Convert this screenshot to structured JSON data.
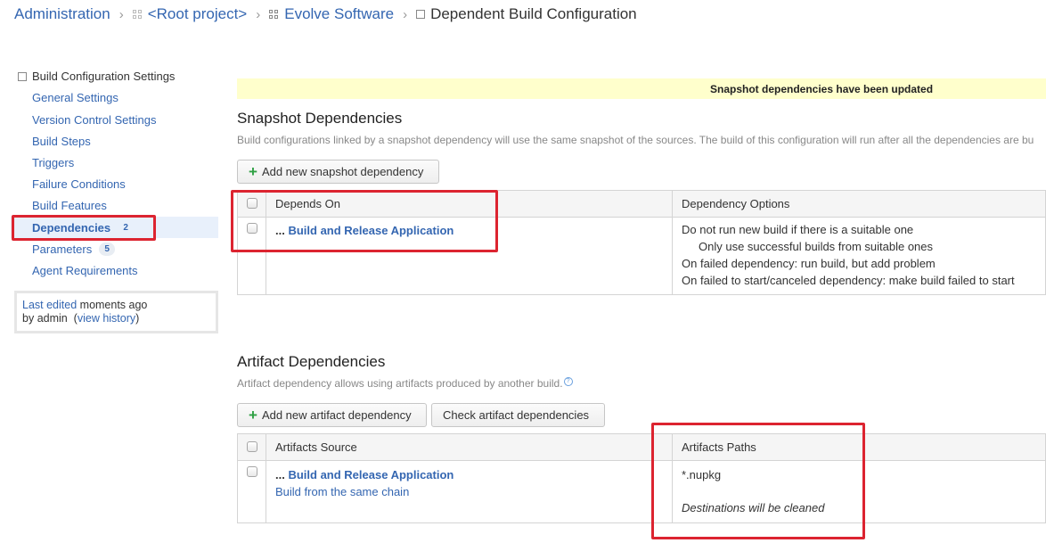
{
  "breadcrumb": {
    "items": [
      {
        "label": "Administration",
        "icon": null
      },
      {
        "label": "<Root project>",
        "icon": "project-icon"
      },
      {
        "label": "Evolve Software",
        "icon": "project-icon"
      }
    ],
    "current": {
      "label": "Dependent Build Configuration",
      "icon": "build-config-icon"
    },
    "separator": "›"
  },
  "sidebar": {
    "header": "Build Configuration Settings",
    "items": [
      {
        "label": "General Settings",
        "badge": null,
        "active": false
      },
      {
        "label": "Version Control Settings",
        "badge": null,
        "active": false
      },
      {
        "label": "Build Steps",
        "badge": null,
        "active": false
      },
      {
        "label": "Triggers",
        "badge": null,
        "active": false
      },
      {
        "label": "Failure Conditions",
        "badge": null,
        "active": false
      },
      {
        "label": "Build Features",
        "badge": null,
        "active": false
      },
      {
        "label": "Dependencies",
        "badge": "2",
        "active": true
      },
      {
        "label": "Parameters",
        "badge": "5",
        "active": false
      },
      {
        "label": "Agent Requirements",
        "badge": null,
        "active": false
      }
    ],
    "last_edited": {
      "link": "Last edited",
      "when": "moments ago",
      "by_prefix": "by",
      "user": "admin",
      "history_link": "view history"
    }
  },
  "notice": "Snapshot dependencies have been updated",
  "snapshot": {
    "title": "Snapshot Dependencies",
    "description": "Build configurations linked by a snapshot dependency will use the same snapshot of the sources. The build of this configuration will run after all the dependencies are bu",
    "add_button": "Add new snapshot dependency",
    "columns": [
      "Depends On",
      "Dependency Options"
    ],
    "rows": [
      {
        "prefix": "...",
        "name": "Build and Release Application",
        "options": [
          {
            "text": "Do not run new build if there is a suitable one",
            "indent": false
          },
          {
            "text": "Only use successful builds from suitable ones",
            "indent": true
          },
          {
            "text": "On failed dependency: run build, but add problem",
            "indent": false
          },
          {
            "text": "On failed to start/canceled dependency: make build failed to start",
            "indent": false
          }
        ]
      }
    ]
  },
  "artifact": {
    "title": "Artifact Dependencies",
    "description": "Artifact dependency allows using artifacts produced by another build.",
    "help_icon": "?",
    "add_button": "Add new artifact dependency",
    "check_button": "Check artifact dependencies",
    "columns": [
      "Artifacts Source",
      "Artifacts Paths"
    ],
    "rows": [
      {
        "prefix": "...",
        "name": "Build and Release Application",
        "source_detail": "Build from the same chain",
        "paths": "*.nupkg",
        "note": "Destinations will be cleaned"
      }
    ]
  },
  "colors": {
    "link": "#3466b1",
    "highlight": "#dc2430",
    "notice_bg": "#ffffcc",
    "active_bg": "#e8f0fb"
  }
}
